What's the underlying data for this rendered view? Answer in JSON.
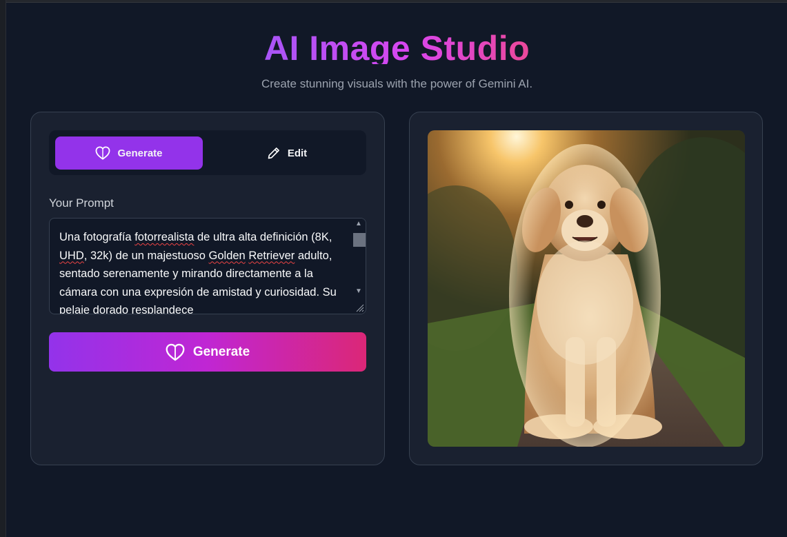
{
  "header": {
    "title": "AI Image Studio",
    "subtitle": "Create stunning visuals with the power of Gemini AI."
  },
  "tabs": [
    {
      "label": "Generate",
      "icon": "heart-icon",
      "active": true
    },
    {
      "label": "Edit",
      "icon": "pencil-icon",
      "active": false
    }
  ],
  "prompt": {
    "label": "Your Prompt",
    "value": "Una fotografía fotorrealista de ultra alta definición (8K, UHD, 32k) de un majestuoso Golden Retriever adulto, sentado serenamente y mirando directamente a la cámara con una expresión de amistad y curiosidad. Su pelaje dorado resplandece"
  },
  "generate_button": {
    "label": "Generate",
    "icon": "heart-icon"
  },
  "preview": {
    "subject": "golden retriever sitting on path at sunset",
    "icon": "generated-image"
  },
  "colors": {
    "background": "#111827",
    "panel": "#1a2130",
    "accent_purple": "#9333ea",
    "accent_pink": "#db2777"
  }
}
